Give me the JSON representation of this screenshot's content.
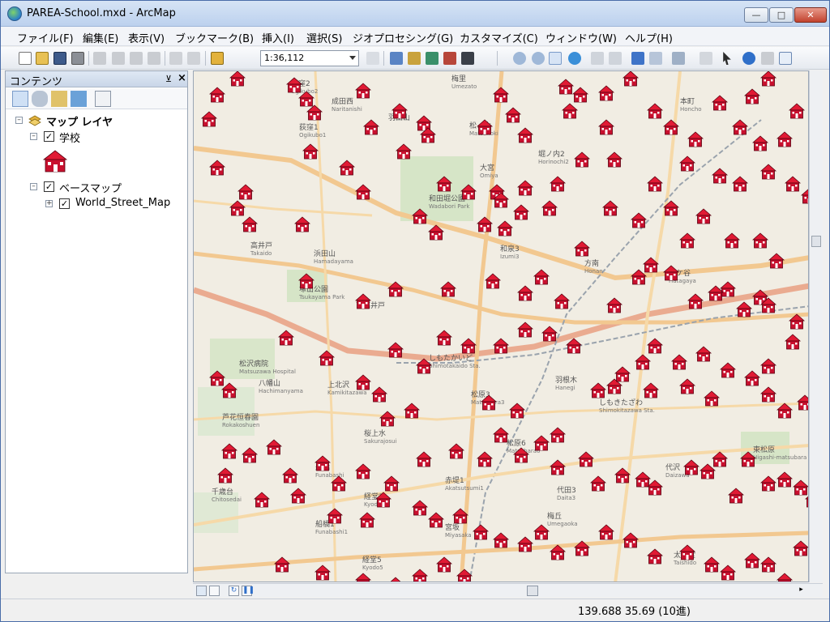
{
  "window": {
    "title": "PAREA-School.mxd - ArcMap"
  },
  "menu": [
    "ファイル(F)",
    "編集(E)",
    "表示(V)",
    "ブックマーク(B)",
    "挿入(I)",
    "選択(S)",
    "ジオプロセシング(G)",
    "カスタマイズ(C)",
    "ウィンドウ(W)",
    "ヘルプ(H)"
  ],
  "toolbar": {
    "scale": "1:36,112"
  },
  "toc": {
    "title": "コンテンツ",
    "root": "マップ レイヤ",
    "layer_school": "学校",
    "group_basemap": "ベースマップ",
    "layer_street": "World_Street_Map"
  },
  "map": {
    "labels": [
      {
        "t": "荻窪2",
        "s": "Ogikubo2"
      },
      {
        "t": "成田西",
        "s": "Naritanishi"
      },
      {
        "t": "梅里",
        "s": "Umezato"
      },
      {
        "t": "松ノ木",
        "s": "Matsunoki"
      },
      {
        "t": "堀ノ内2",
        "s": "Horinochi2"
      },
      {
        "t": "大宮",
        "s": "Omiya"
      },
      {
        "t": "和田堀公園",
        "s": "Wadabori Park"
      },
      {
        "t": "本町",
        "s": "Honcho"
      },
      {
        "t": "荻窪1",
        "s": "Ogikubo1"
      },
      {
        "t": "高井戸",
        "s": "Takaido"
      },
      {
        "t": "浜田山",
        "s": "Hamadayama"
      },
      {
        "t": "和泉3",
        "s": "Izumi3"
      },
      {
        "t": "方南",
        "s": "Honan"
      },
      {
        "t": "幡ケ谷",
        "s": "Hatagaya"
      },
      {
        "t": "塚山公園",
        "s": "Tsukayama Park"
      },
      {
        "t": "下高井戸",
        "s": ""
      },
      {
        "t": "しもたかいど",
        "s": "Shimotakaido Sta."
      },
      {
        "t": "羽根木",
        "s": "Hanegi"
      },
      {
        "t": "八幡山",
        "s": "Hachimanyama"
      },
      {
        "t": "上北沢",
        "s": "Kamikitazawa"
      },
      {
        "t": "桜上水",
        "s": "Sakurajosui"
      },
      {
        "t": "松原3",
        "s": "Matsubara3"
      },
      {
        "t": "しもきたざわ",
        "s": "Shimokitazawa Sta."
      },
      {
        "t": "松原6",
        "s": "Matsubara6"
      },
      {
        "t": "代沢",
        "s": "Daizawa"
      },
      {
        "t": "船橋",
        "s": "Funabashi"
      },
      {
        "t": "赤堤1",
        "s": "Akatsutsumi1"
      },
      {
        "t": "経堂2",
        "s": "Kyodo2"
      },
      {
        "t": "千歳台",
        "s": "Chitosedai"
      },
      {
        "t": "代田3",
        "s": "Daita3"
      },
      {
        "t": "梅丘",
        "s": "Umegaoka"
      },
      {
        "t": "宮坂",
        "s": "Miyasaka"
      },
      {
        "t": "船橋1",
        "s": "Funabashi1"
      },
      {
        "t": "経堂5",
        "s": "Kyodo5"
      },
      {
        "t": "太子堂",
        "s": "Taishido"
      },
      {
        "t": "松沢病院",
        "s": "Matsuzawa Hospital"
      },
      {
        "t": "芦花恒春園",
        "s": "Rokakoshuen"
      },
      {
        "t": "東松原",
        "s": "Higashi-matsubara"
      },
      {
        "t": "羽田山",
        "s": ""
      }
    ]
  },
  "status": {
    "coords": "139.688  35.69 (10進)"
  }
}
